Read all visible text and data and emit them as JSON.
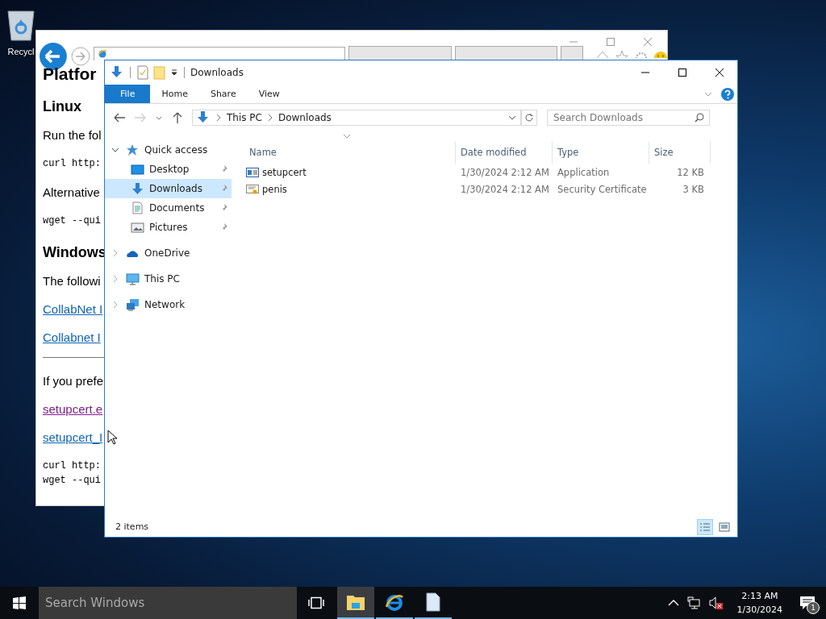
{
  "desktop": {
    "icons": [
      {
        "label": "Recycl"
      }
    ]
  },
  "browser": {
    "page": [
      {
        "kind": "h1",
        "text": "Platfor"
      },
      {
        "kind": "h2",
        "text": "Linux"
      },
      {
        "kind": "p",
        "text": "Run the fol"
      },
      {
        "kind": "code",
        "lines": [
          "curl http:"
        ]
      },
      {
        "kind": "p",
        "text": "Alternative"
      },
      {
        "kind": "code",
        "lines": [
          "wget --qui"
        ]
      },
      {
        "kind": "h2",
        "text": "Windows"
      },
      {
        "kind": "p",
        "text": "The followi"
      },
      {
        "kind": "link",
        "text": "CollabNet I",
        "visited": false
      },
      {
        "kind": "link",
        "text": "Collabnet I",
        "visited": false
      },
      {
        "kind": "rule"
      },
      {
        "kind": "p",
        "text": "If you prefe"
      },
      {
        "kind": "link",
        "text": "setupcert.e",
        "visited": true
      },
      {
        "kind": "link",
        "text": "setupcert_I",
        "visited": false
      },
      {
        "kind": "code",
        "lines": [
          "curl http:",
          "wget --qui"
        ]
      }
    ]
  },
  "explorer": {
    "title": "Downloads",
    "ribbon_tabs": [
      {
        "label": "File",
        "selected": true
      },
      {
        "label": "Home",
        "selected": false
      },
      {
        "label": "Share",
        "selected": false
      },
      {
        "label": "View",
        "selected": false
      }
    ],
    "breadcrumbs": [
      "This PC",
      "Downloads"
    ],
    "search": {
      "placeholder": "Search Downloads"
    },
    "nav": [
      {
        "label": "Quick access",
        "kind": "star",
        "expanded": true,
        "selected": false,
        "children": [
          {
            "label": "Desktop",
            "kind": "desktop",
            "pinned": true,
            "selected": false
          },
          {
            "label": "Downloads",
            "kind": "download",
            "pinned": true,
            "selected": true
          },
          {
            "label": "Documents",
            "kind": "documents",
            "pinned": true,
            "selected": false
          },
          {
            "label": "Pictures",
            "kind": "pictures",
            "pinned": true,
            "selected": false
          }
        ]
      },
      {
        "label": "OneDrive",
        "kind": "cloud",
        "expanded": false,
        "selected": false
      },
      {
        "label": "This PC",
        "kind": "pc",
        "expanded": false,
        "selected": false
      },
      {
        "label": "Network",
        "kind": "network",
        "expanded": false,
        "selected": false
      }
    ],
    "columns": [
      "Name",
      "Date modified",
      "Type",
      "Size"
    ],
    "files": [
      {
        "kind": "application",
        "name": "setupcert",
        "date": "1/30/2024 2:12 AM",
        "type": "Application",
        "size": "12 KB",
        "selected": false
      },
      {
        "kind": "certificate",
        "name": "penis",
        "date": "1/30/2024 2:12 AM",
        "type": "Security Certificate",
        "size": "3 KB",
        "selected": false
      }
    ],
    "status": "2 items",
    "views": [
      {
        "kind": "details",
        "selected": true
      },
      {
        "kind": "large",
        "selected": false
      }
    ]
  },
  "taskbar": {
    "search": {
      "placeholder": "Search Windows"
    },
    "apps": [
      {
        "kind": "explorer",
        "active": true
      },
      {
        "kind": "ie",
        "active": false
      },
      {
        "kind": "file",
        "active": false
      }
    ],
    "time": "2:13 AM",
    "date": "1/30/2024",
    "notifications": "1"
  }
}
